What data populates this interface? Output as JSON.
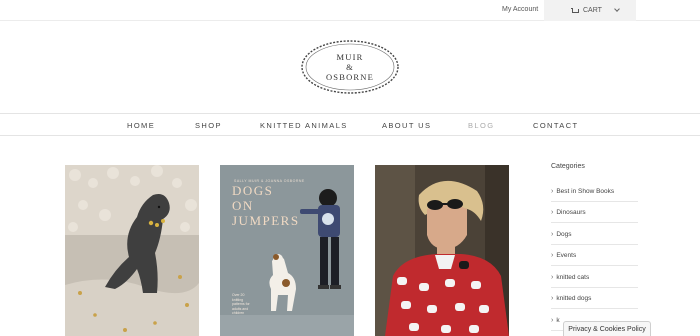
{
  "topbar": {
    "account_label": "My Account",
    "cart_label": "CART"
  },
  "logo": {
    "line1": "MUIR",
    "line2": "&",
    "line3": "OSBORNE"
  },
  "nav": {
    "items": [
      {
        "label": "HOME"
      },
      {
        "label": "SHOP"
      },
      {
        "label": "KNITTED ANIMALS"
      },
      {
        "label": "ABOUT US"
      },
      {
        "label": "BLOG",
        "active": true
      },
      {
        "label": "CONTACT"
      }
    ]
  },
  "posts": {
    "book": {
      "author": "SALLY MUIR & JOANNA OSBORNE",
      "title_line1": "DOGS",
      "title_line2": "ON",
      "title_line3": "JUMPERS",
      "subtitle": "Over 20 knitting patterns for adults and children"
    }
  },
  "sidebar": {
    "heading": "Categories",
    "items": [
      {
        "label": "Best in Show Books"
      },
      {
        "label": "Dinosaurs"
      },
      {
        "label": "Dogs"
      },
      {
        "label": "Events"
      },
      {
        "label": "knitted cats"
      },
      {
        "label": "knitted dogs"
      },
      {
        "label": "k"
      }
    ]
  },
  "cookie": {
    "label": "Privacy & Cookies Policy"
  },
  "colors": {
    "active_nav": "#aaaaaa",
    "accent_red": "#c02a2e",
    "book_cover": "#8f9a9e"
  }
}
